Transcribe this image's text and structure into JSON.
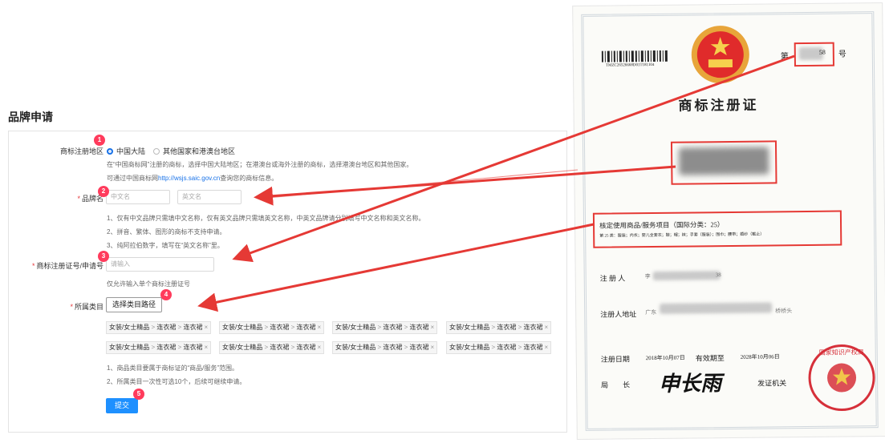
{
  "page_title": "品牌申请",
  "form": {
    "region": {
      "label": "商标注册地区",
      "options": [
        "中国大陆",
        "其他国家和港澳台地区"
      ],
      "selected": "中国大陆",
      "help_1": "在“中国商标网”注册的商标，选择中国大陆地区；在港澳台或海外注册的商标，选择港澳台地区和其他国家。",
      "help_2_prefix": "可通过中国商标网",
      "help_2_link": "http://wsjs.saic.gov.cn",
      "help_2_suffix": "查询您的商标信息。"
    },
    "brand_name": {
      "label": "品牌名",
      "placeholder_cn": "中文名",
      "placeholder_en": "英文名",
      "help": [
        "1、仅有中文品牌只需填中文名称，仅有英文品牌只需填英文名称，中英文品牌请分别填写中文名称和英文名称。",
        "2、拼音、繁体、图形的商标不支持申请。",
        "3、纯阿拉伯数字，填写在“英文名称”里。"
      ]
    },
    "reg_number": {
      "label": "商标注册证号/申请号",
      "placeholder": "请输入",
      "help": "仅允许输入单个商标注册证号"
    },
    "category": {
      "label": "所属类目",
      "button": "选择类目路径",
      "tag_parts": [
        "女装/女士精品",
        "连衣裙",
        "连衣裙"
      ],
      "tag_count": 8,
      "help": [
        "1、商品类目要属于商标证的“商品/服务”范围。",
        "2、所属类目一次性可选10个，后续可继续申请。"
      ]
    },
    "submit": "提交"
  },
  "badges": [
    "1",
    "2",
    "3",
    "4",
    "5"
  ],
  "certificate": {
    "title": "商标注册证",
    "no_prefix": "第",
    "no_suffix": "号",
    "number_visible": "58",
    "barcode_text": "TMZC26526668D01T181104",
    "scope_title": "核定使用商品/服务项目（国际分类：25）",
    "scope_detail": "第 25 类：服装；内衣；婴儿全套衣；鞋；帽；袜；手套（服装）；围巾；腰带；婚纱（截止）",
    "registrant_label": "注 册 人",
    "registrant_value_a": "李",
    "registrant_value_b": "38",
    "address_label": "注册人地址",
    "address_value_a": "广东",
    "address_value_b": "桥桥头",
    "date_label": "注册日期",
    "date_value": "2018年10月07日",
    "valid_label": "有效期至",
    "valid_value": "2028年10月06日",
    "director_label": "局　　长",
    "signature": "申长雨",
    "issuer_label": "发证机关",
    "seal_text": "国家知识产权局"
  },
  "colors": {
    "accent": "#1e90ff",
    "badge": "#ff3b5c",
    "arrow": "#e53935",
    "required": "#e4393c"
  }
}
